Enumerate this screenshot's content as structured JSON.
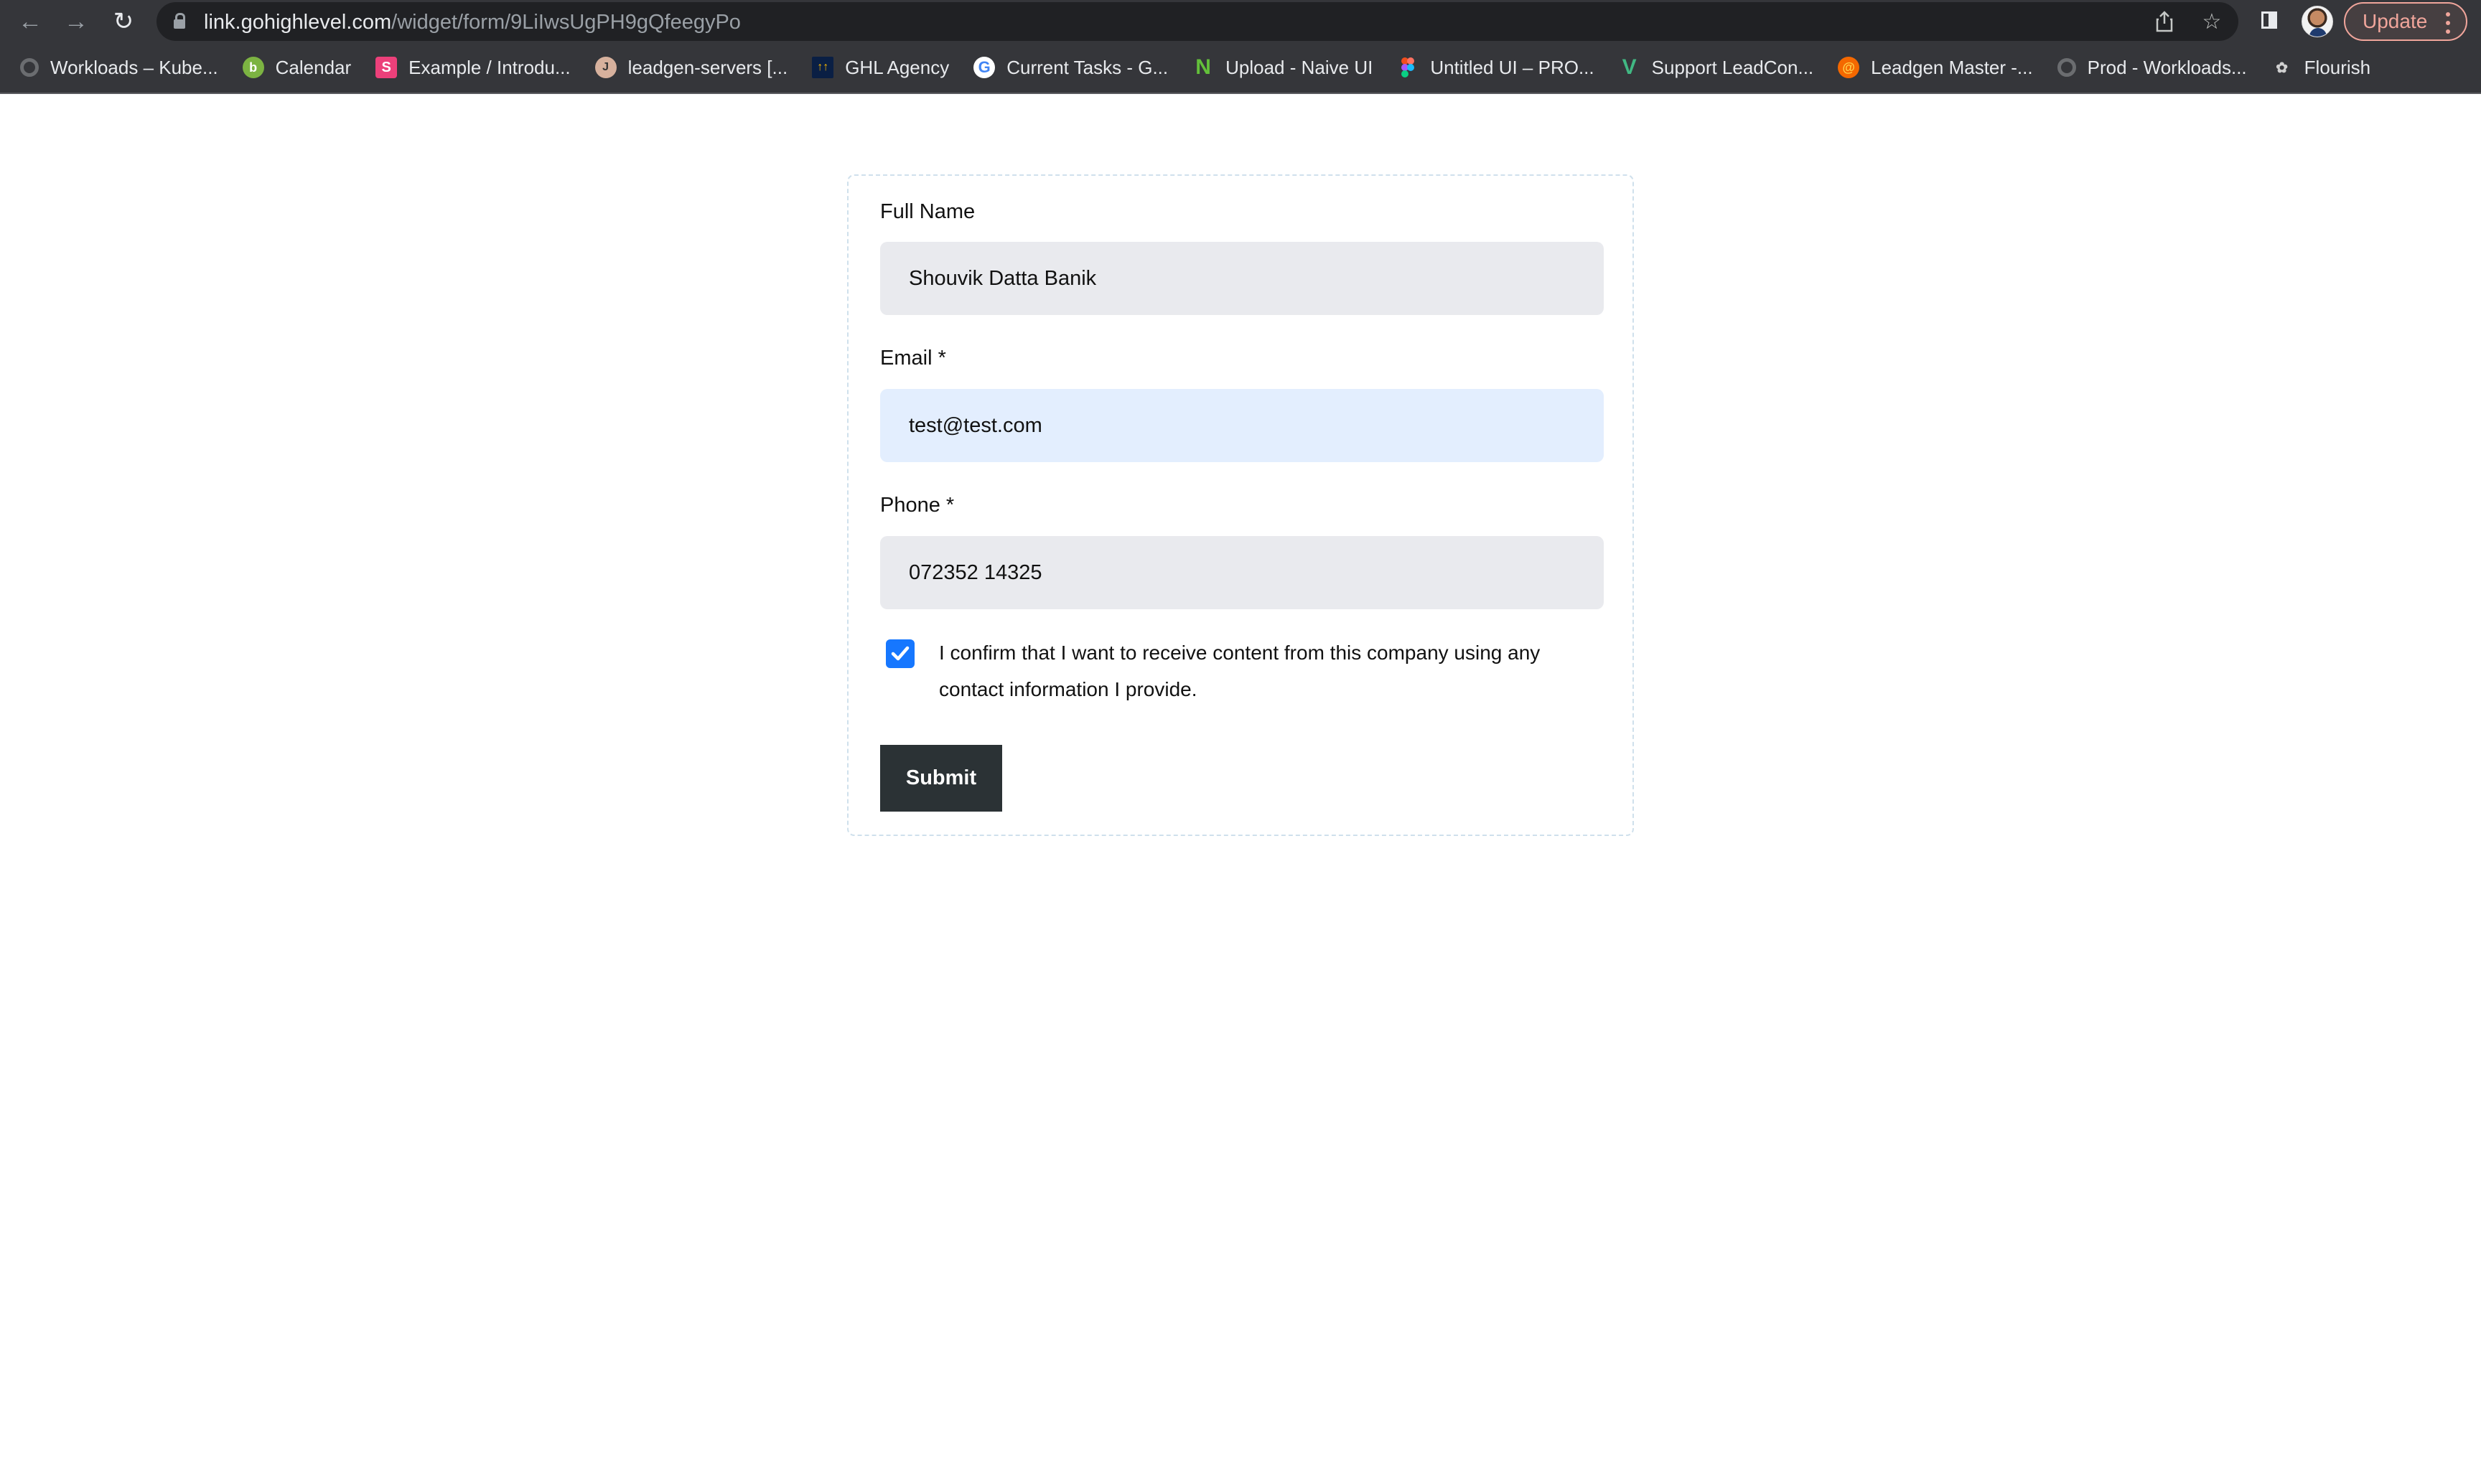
{
  "browser": {
    "url_host": "link.gohighlevel.com",
    "url_path": "/widget/form/9LiIwsUgPH9gQfeegyPo",
    "update_label": "Update",
    "icons": {
      "back": "arrow-left-icon",
      "forward": "arrow-right-icon",
      "reload": "reload-icon",
      "lock": "lock-icon",
      "share": "share-icon",
      "bookmark": "star-icon",
      "side_panel": "side-panel-icon",
      "profile": "avatar",
      "menu": "kebab-menu-icon"
    },
    "bookmarks": [
      {
        "label": "Workloads – Kube...",
        "icon": "kubernetes-icon"
      },
      {
        "label": "Calendar",
        "icon": "calendar-icon"
      },
      {
        "label": "Example / Introdu...",
        "icon": "storybook-icon"
      },
      {
        "label": "leadgen-servers [...",
        "icon": "jenkins-icon"
      },
      {
        "label": "GHL Agency",
        "icon": "ghl-icon"
      },
      {
        "label": "Current Tasks - G...",
        "icon": "google-icon"
      },
      {
        "label": "Upload - Naive UI",
        "icon": "naive-ui-icon"
      },
      {
        "label": "Untitled UI – PRO...",
        "icon": "figma-icon"
      },
      {
        "label": "Support LeadCon...",
        "icon": "vue-icon"
      },
      {
        "label": "Leadgen Master -...",
        "icon": "grafana-icon"
      },
      {
        "label": "Prod - Workloads...",
        "icon": "kubernetes-icon"
      },
      {
        "label": "Flourish",
        "icon": "flourish-icon"
      }
    ]
  },
  "form": {
    "fields": [
      {
        "label": "Full Name",
        "value": "Shouvik Datta Banik",
        "focused": false
      },
      {
        "label": "Email *",
        "value": "test@test.com",
        "focused": true
      },
      {
        "label": "Phone *",
        "value": "072352 14325",
        "focused": false
      }
    ],
    "consent": {
      "checked": true,
      "text": "I confirm that I want to receive content from this company using any contact information I provide."
    },
    "submit_label": "Submit"
  },
  "colors": {
    "chrome_bg": "#35363a",
    "omnibox_bg": "#202124",
    "update_accent": "#f0a59b",
    "input_bg": "#e9eaee",
    "input_focused_bg": "#e3eefe",
    "checkbox": "#1677ff",
    "submit_bg": "#2b3235",
    "card_border": "#cfe0ec"
  }
}
